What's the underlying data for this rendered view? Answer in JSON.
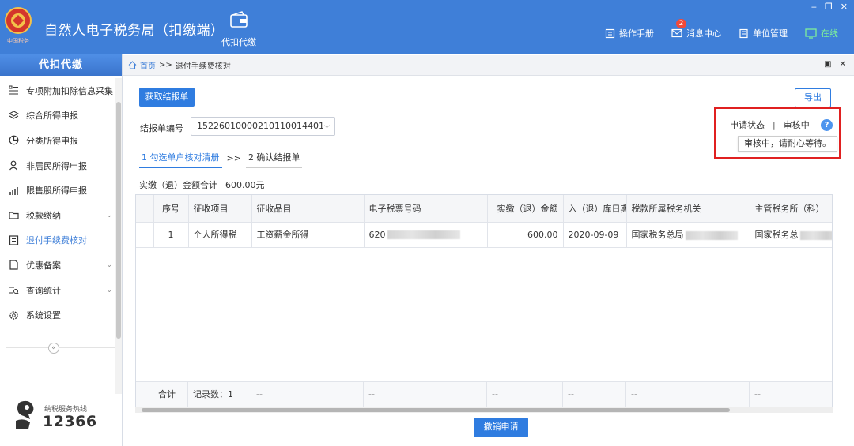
{
  "header": {
    "app_title": "自然人电子税务局（扣缴端）",
    "nav_label": "代扣代缴",
    "tools": [
      {
        "label": "操作手册",
        "icon": "manual-icon"
      },
      {
        "label": "消息中心",
        "icon": "message-icon",
        "badge": "2"
      },
      {
        "label": "单位管理",
        "icon": "building-icon"
      },
      {
        "label": "在线",
        "icon": "monitor-icon"
      }
    ],
    "logo_caption": "中国税务"
  },
  "sidebar": {
    "title": "代扣代缴",
    "items": [
      {
        "label": "专项附加扣除信息采集",
        "icon": "list-icon"
      },
      {
        "label": "综合所得申报",
        "icon": "layers-icon"
      },
      {
        "label": "分类所得申报",
        "icon": "pie-icon"
      },
      {
        "label": "非居民所得申报",
        "icon": "person-icon"
      },
      {
        "label": "限售股所得申报",
        "icon": "bars-icon"
      },
      {
        "label": "税款缴纳",
        "icon": "folder-icon",
        "expandable": true
      },
      {
        "label": "退付手续费核对",
        "icon": "document-icon",
        "active": true
      },
      {
        "label": "优惠备案",
        "icon": "file-icon",
        "expandable": true
      },
      {
        "label": "查询统计",
        "icon": "query-icon",
        "expandable": true
      },
      {
        "label": "系统设置",
        "icon": "gear-icon"
      }
    ],
    "hotline_label": "纳税服务热线",
    "hotline_number": "12366"
  },
  "breadcrumb": {
    "home": "首页",
    "separator": ">>",
    "current": "退付手续费核对"
  },
  "main": {
    "get_report_button": "获取结报单",
    "export_button": "导出",
    "report_no_label": "结报单编号",
    "report_no_value": "15226010000210110014401",
    "steps": {
      "step1": "1 勾选单户核对清册",
      "separator": ">>",
      "step2": "2 确认结报单"
    },
    "total_label": "实缴（退）金额合计",
    "total_value": "600.00元",
    "status": {
      "label": "申请状态",
      "divider": "|",
      "value": "审核中",
      "help": "?",
      "tip": "审核中，请耐心等待。"
    },
    "revoke_button": "撤销申请"
  },
  "table": {
    "headers": [
      "序号",
      "征收项目",
      "征收品目",
      "电子税票号码",
      "实缴（退）金额",
      "入（退）库日期",
      "税款所属税务机关",
      "主管税务所（科）"
    ],
    "rows": [
      {
        "index": "1",
        "item": "个人所得税",
        "subitem": "工资薪金所得",
        "ticket_prefix": "620",
        "amount": "600.00",
        "date": "2020-09-09",
        "authority_prefix": "国家税务总局",
        "office_prefix": "国家税务总"
      }
    ],
    "footer": {
      "total_label": "合计",
      "record_count": "记录数：1",
      "placeholder": "--"
    }
  }
}
